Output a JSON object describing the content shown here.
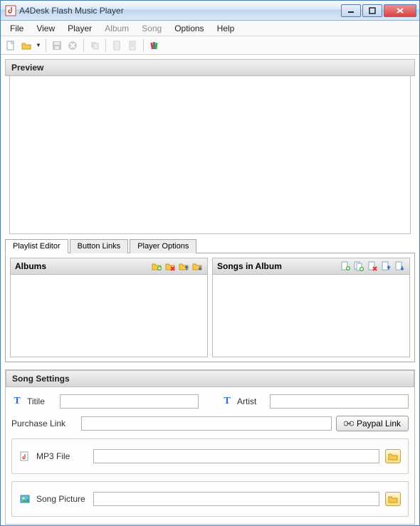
{
  "window": {
    "title": "A4Desk Flash Music Player"
  },
  "menu": {
    "file": "File",
    "view": "View",
    "player": "Player",
    "album": "Album",
    "song": "Song",
    "options": "Options",
    "help": "Help"
  },
  "toolbar": {
    "new": "new",
    "open": "open",
    "save": "save",
    "cancel": "cancel",
    "copy": "copy",
    "page1": "page1",
    "page2": "page2",
    "books": "books"
  },
  "preview": {
    "title": "Preview"
  },
  "tabs": {
    "playlist": "Playlist Editor",
    "buttons": "Button Links",
    "options": "Player Options"
  },
  "albums": {
    "title": "Albums"
  },
  "songs": {
    "title": "Songs in Album"
  },
  "settings": {
    "title": "Song Settings",
    "title_label": "Titile",
    "artist_label": "Artist",
    "purchase_label": "Purchase Link",
    "paypal_btn": "Paypal Link",
    "mp3_label": "MP3 File",
    "picture_label": "Song Picture",
    "title_value": "",
    "artist_value": "",
    "purchase_value": "",
    "mp3_value": "",
    "picture_value": ""
  }
}
